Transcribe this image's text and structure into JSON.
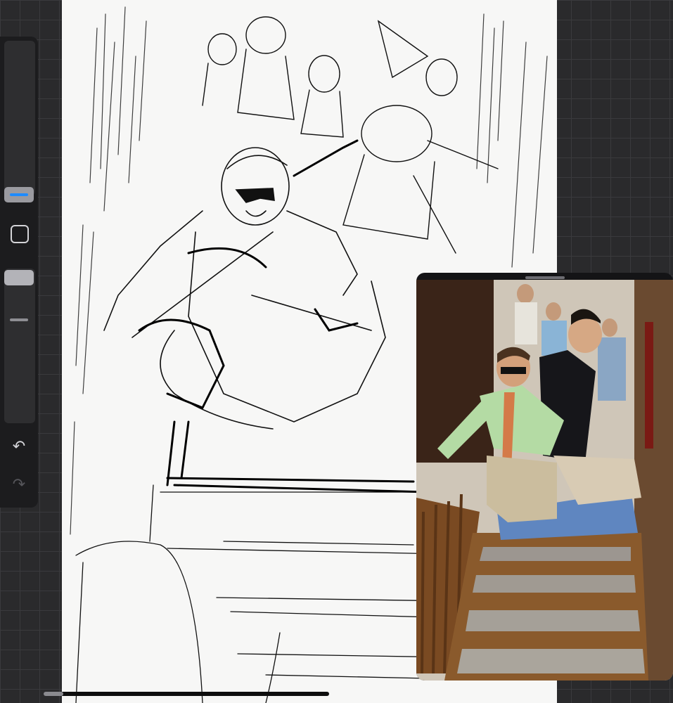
{
  "app": {
    "accent_color": "#1e8bff",
    "canvas_color": "#f7f7f6",
    "background_color": "#2a2a2c"
  },
  "sidebar": {
    "brush_size_slider": {
      "icon": "brush-size-slider"
    },
    "modify_button": {
      "icon": "square-outline-icon"
    },
    "opacity_slider": {
      "icon": "opacity-slider"
    },
    "undo": {
      "icon": "undo-arrow-icon",
      "glyph": "↶"
    },
    "redo": {
      "icon": "redo-arrow-icon",
      "glyph": "↷"
    }
  },
  "canvas": {
    "content": "pencil-sketch"
  },
  "reference": {
    "window": "reference-photo-window",
    "photo": "photo"
  }
}
